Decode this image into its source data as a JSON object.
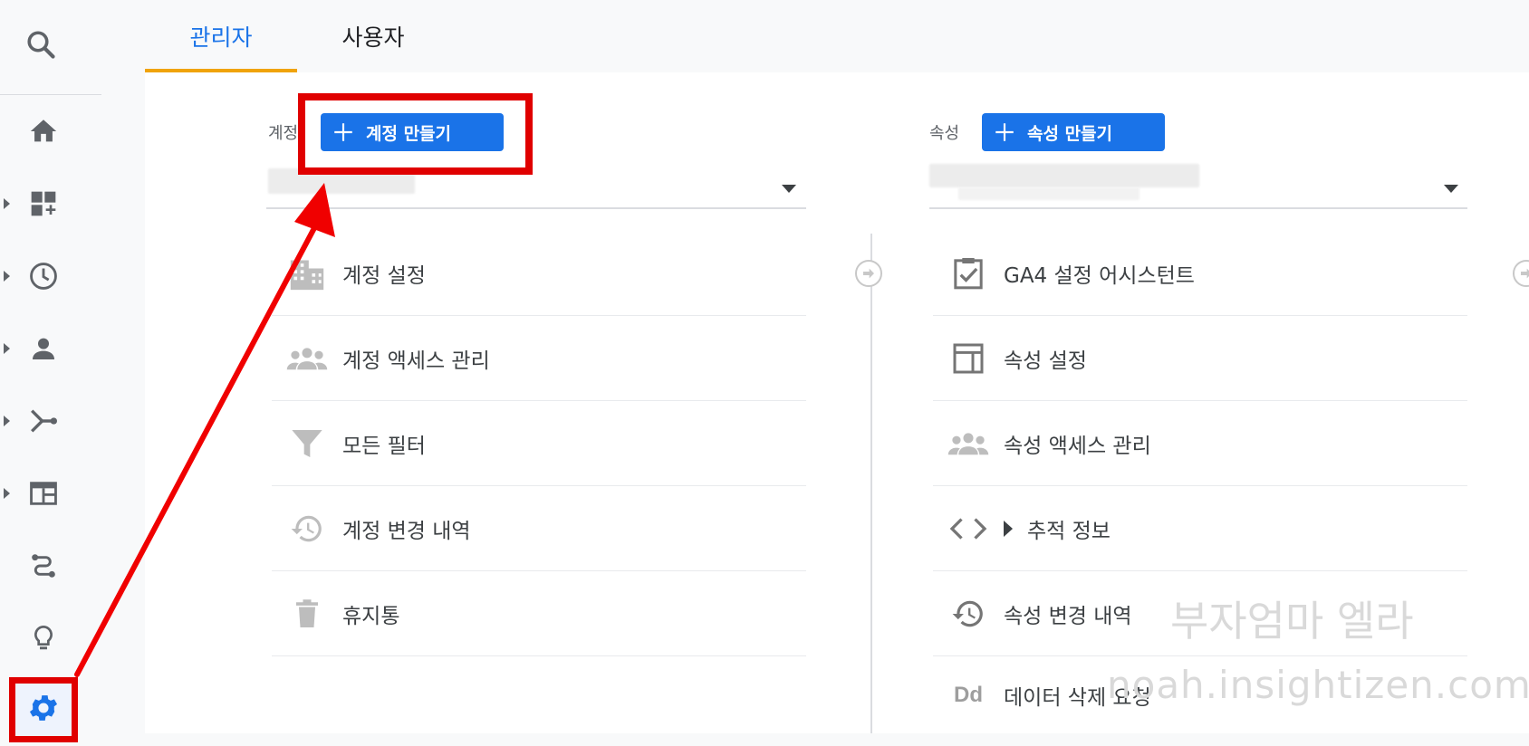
{
  "tabs": {
    "admin": "관리자",
    "user": "사용자"
  },
  "account": {
    "label": "계정",
    "create_button": "계정 만들기",
    "items": [
      {
        "label": "계정 설정",
        "icon": "building-icon"
      },
      {
        "label": "계정 액세스 관리",
        "icon": "people-icon"
      },
      {
        "label": "모든 필터",
        "icon": "filter-icon"
      },
      {
        "label": "계정 변경 내역",
        "icon": "history-icon"
      },
      {
        "label": "휴지통",
        "icon": "trash-icon"
      }
    ]
  },
  "property": {
    "label": "속성",
    "create_button": "속성 만들기",
    "items": [
      {
        "label": "GA4 설정 어시스턴트",
        "icon": "checklist-icon"
      },
      {
        "label": "속성 설정",
        "icon": "layout-icon"
      },
      {
        "label": "속성 액세스 관리",
        "icon": "people-icon"
      },
      {
        "label": "추적 정보",
        "icon": "code-icon"
      },
      {
        "label": "속성 변경 내역",
        "icon": "history-icon"
      },
      {
        "label": "데이터 삭제 요청",
        "icon": "dd-icon"
      }
    ],
    "dd_glyph": "Dd"
  },
  "watermark": {
    "line1": "부자엄마 엘라",
    "line2": "noah.insightizen.com"
  },
  "colors": {
    "accent": "#1a73e8",
    "tab_indicator": "#f0a30a",
    "highlight": "#e00000"
  }
}
